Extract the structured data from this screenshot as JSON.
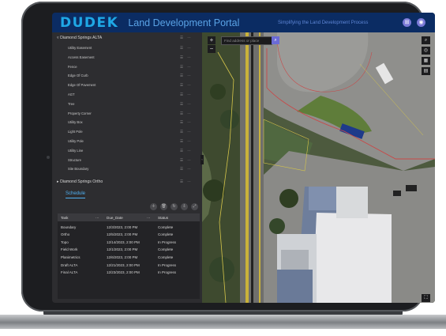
{
  "header": {
    "logo": "DUDEK",
    "title": "Land Development Portal",
    "tagline": "Simplifying the Land Development Process",
    "buttons": [
      {
        "icon": "grid-icon",
        "glyph": "⊞"
      },
      {
        "icon": "user-icon",
        "glyph": "◉"
      }
    ]
  },
  "layers": {
    "group_expanded": {
      "label": "Diamond Springs ALTA",
      "caret": "▿"
    },
    "items": [
      "Utility Easement",
      "Access Easement",
      "Fence",
      "Edge Of Curb",
      "Edge Of Pavement",
      "AGT",
      "Tree",
      "Property Corner",
      "Utility Box",
      "Light Pole",
      "Utility Pole",
      "Utility Line",
      "Structure",
      "Site Boundary"
    ],
    "group_collapsed": {
      "label": "Diamond Springs Ortho",
      "caret": "▸"
    },
    "row_icons": "☰ ⋯"
  },
  "schedule": {
    "tab_label": "Schedule",
    "toolbar_icons": [
      {
        "name": "add-icon",
        "glyph": "＋"
      },
      {
        "name": "delete-icon",
        "glyph": "🗑"
      },
      {
        "name": "refresh-icon",
        "glyph": "↻"
      },
      {
        "name": "export-icon",
        "glyph": "⇩"
      },
      {
        "name": "fullscreen-icon",
        "glyph": "⤢"
      }
    ],
    "columns": [
      "Task",
      "Due_Date",
      "Status"
    ],
    "column_menu": "⋯",
    "rows": [
      {
        "task": "Boundary",
        "due": "12/3/2023, 2:00 PM",
        "status": "Complete"
      },
      {
        "task": "Ortho",
        "due": "12/5/2023, 2:00 PM",
        "status": "Complete"
      },
      {
        "task": "Topo",
        "due": "12/14/2023, 2:00 PM",
        "status": "In Progress"
      },
      {
        "task": "Field Work",
        "due": "12/1/2023, 2:00 PM",
        "status": "Complete"
      },
      {
        "task": "Planimetrics",
        "due": "12/6/2023, 2:00 PM",
        "status": "Complete"
      },
      {
        "task": "Draft ALTA",
        "due": "12/21/2023, 2:00 PM",
        "status": "In Progress"
      },
      {
        "task": "Final ALTA",
        "due": "12/23/2023, 2:00 PM",
        "status": "In Progress"
      }
    ]
  },
  "map": {
    "search_placeholder": "Find address or place",
    "search_icon": "⌕",
    "zoom_in": "+",
    "zoom_out": "−",
    "tools": [
      {
        "name": "search-tool-icon",
        "glyph": "⌕"
      },
      {
        "name": "layers-tool-icon",
        "glyph": "◎"
      },
      {
        "name": "basemap-icon",
        "glyph": "▦"
      },
      {
        "name": "print-icon",
        "glyph": "▤"
      }
    ],
    "fullscreen": "⛶"
  },
  "colors": {
    "header_bg": "#0b2c63",
    "logo": "#1fa8e6",
    "accent": "#6b6bd6",
    "panel_bg": "#2d2d30",
    "table_bg": "#232326"
  }
}
